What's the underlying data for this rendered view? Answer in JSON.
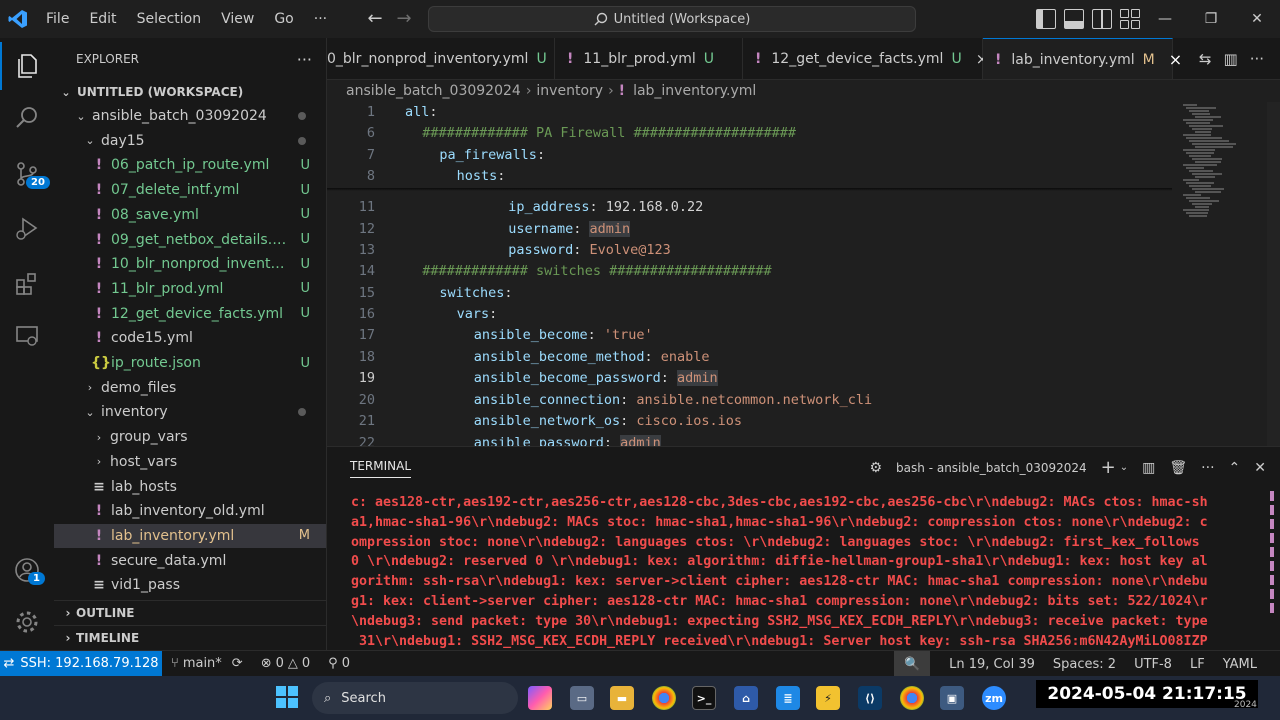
{
  "titlebar": {
    "logo": "VS Code logo",
    "menus": [
      "File",
      "Edit",
      "Selection",
      "View",
      "Go",
      "···"
    ],
    "command_center": "Untitled (Workspace)"
  },
  "activity": {
    "source_control_badge": "20",
    "accounts_badge": "1"
  },
  "sidebar": {
    "title": "EXPLORER",
    "workspace": "UNTITLED (WORKSPACE)",
    "items": [
      {
        "label": "ansible_batch_03092024",
        "kind": "folder-open",
        "depth": 1,
        "status": "dot"
      },
      {
        "label": "day15",
        "kind": "folder-open",
        "depth": 2,
        "status": "dot"
      },
      {
        "label": "06_patch_ip_route.yml",
        "kind": "yml",
        "depth": 3,
        "status": "U"
      },
      {
        "label": "07_delete_intf.yml",
        "kind": "yml",
        "depth": 3,
        "status": "U"
      },
      {
        "label": "08_save.yml",
        "kind": "yml",
        "depth": 3,
        "status": "U"
      },
      {
        "label": "09_get_netbox_details.yml",
        "kind": "yml",
        "depth": 3,
        "status": "U"
      },
      {
        "label": "10_blr_nonprod_inventory....",
        "kind": "yml",
        "depth": 3,
        "status": "U"
      },
      {
        "label": "11_blr_prod.yml",
        "kind": "yml",
        "depth": 3,
        "status": "U"
      },
      {
        "label": "12_get_device_facts.yml",
        "kind": "yml",
        "depth": 3,
        "status": "U"
      },
      {
        "label": "code15.yml",
        "kind": "yml",
        "depth": 3,
        "status": ""
      },
      {
        "label": "ip_route.json",
        "kind": "json",
        "depth": 3,
        "status": "U"
      },
      {
        "label": "demo_files",
        "kind": "folder",
        "depth": 2,
        "status": ""
      },
      {
        "label": "inventory",
        "kind": "folder-open",
        "depth": 2,
        "status": "dot"
      },
      {
        "label": "group_vars",
        "kind": "folder",
        "depth": 3,
        "status": ""
      },
      {
        "label": "host_vars",
        "kind": "folder",
        "depth": 3,
        "status": ""
      },
      {
        "label": "lab_hosts",
        "kind": "txt",
        "depth": 3,
        "status": ""
      },
      {
        "label": "lab_inventory_old.yml",
        "kind": "yml",
        "depth": 3,
        "status": ""
      },
      {
        "label": "lab_inventory.yml",
        "kind": "yml",
        "depth": 3,
        "status": "M",
        "selected": true
      },
      {
        "label": "secure_data.yml",
        "kind": "yml",
        "depth": 3,
        "status": ""
      },
      {
        "label": "vid1_pass",
        "kind": "txt",
        "depth": 3,
        "status": ""
      }
    ],
    "outline": "OUTLINE",
    "timeline": "TIMELINE"
  },
  "tabs": [
    {
      "label": "0_blr_nonprod_inventory.yml",
      "mark": "U",
      "active": false
    },
    {
      "label": "11_blr_prod.yml",
      "mark": "U",
      "active": false
    },
    {
      "label": "12_get_device_facts.yml",
      "mark": "U",
      "active": false,
      "close": "×"
    },
    {
      "label": "lab_inventory.yml",
      "mark": "M",
      "active": true,
      "close": "×"
    }
  ],
  "breadcrumb": [
    "ansible_batch_03092024",
    "inventory",
    "lab_inventory.yml"
  ],
  "editor": {
    "current_line": "19",
    "lines": [
      {
        "n": "1",
        "indent": 0,
        "parts": [
          [
            "k",
            "all"
          ],
          [
            "p",
            ":"
          ]
        ]
      },
      {
        "n": "6",
        "indent": 2,
        "parts": [
          [
            "c",
            "############# PA Firewall ####################"
          ]
        ]
      },
      {
        "n": "7",
        "indent": 4,
        "parts": [
          [
            "k",
            "pa_firewalls"
          ],
          [
            "p",
            ":"
          ]
        ]
      },
      {
        "n": "8",
        "indent": 6,
        "parts": [
          [
            "k",
            "hosts"
          ],
          [
            "p",
            ":"
          ]
        ]
      },
      {
        "n": "11",
        "indent": 12,
        "parts": [
          [
            "k",
            "ip_address"
          ],
          [
            "p",
            ": "
          ],
          [
            "v",
            "192.168.0.22"
          ]
        ]
      },
      {
        "n": "12",
        "indent": 12,
        "parts": [
          [
            "k",
            "username"
          ],
          [
            "p",
            ": "
          ],
          [
            "h",
            "admin"
          ]
        ]
      },
      {
        "n": "13",
        "indent": 12,
        "parts": [
          [
            "k",
            "password"
          ],
          [
            "p",
            ": "
          ],
          [
            "s",
            "Evolve@123"
          ]
        ]
      },
      {
        "n": "14",
        "indent": 2,
        "parts": [
          [
            "c",
            "############# switches ####################"
          ]
        ]
      },
      {
        "n": "15",
        "indent": 4,
        "parts": [
          [
            "k",
            "switches"
          ],
          [
            "p",
            ":"
          ]
        ]
      },
      {
        "n": "16",
        "indent": 6,
        "parts": [
          [
            "k",
            "vars"
          ],
          [
            "p",
            ":"
          ]
        ]
      },
      {
        "n": "17",
        "indent": 8,
        "parts": [
          [
            "k",
            "ansible_become"
          ],
          [
            "p",
            ": "
          ],
          [
            "s",
            "'true'"
          ]
        ]
      },
      {
        "n": "18",
        "indent": 8,
        "parts": [
          [
            "k",
            "ansible_become_method"
          ],
          [
            "p",
            ": "
          ],
          [
            "s",
            "enable"
          ]
        ]
      },
      {
        "n": "19",
        "indent": 8,
        "parts": [
          [
            "k",
            "ansible_become_password"
          ],
          [
            "p",
            ": "
          ],
          [
            "h",
            "admin"
          ]
        ]
      },
      {
        "n": "20",
        "indent": 8,
        "parts": [
          [
            "k",
            "ansible_connection"
          ],
          [
            "p",
            ": "
          ],
          [
            "s",
            "ansible.netcommon.network_cli"
          ]
        ]
      },
      {
        "n": "21",
        "indent": 8,
        "parts": [
          [
            "k",
            "ansible_network_os"
          ],
          [
            "p",
            ": "
          ],
          [
            "s",
            "cisco.ios.ios"
          ]
        ]
      },
      {
        "n": "22",
        "indent": 8,
        "parts": [
          [
            "k",
            "ansible_password"
          ],
          [
            "p",
            ": "
          ],
          [
            "h",
            "admin"
          ]
        ]
      }
    ]
  },
  "panel": {
    "title": "TERMINAL",
    "shell": "bash - ansible_batch_03092024",
    "lines": [
      "c: aes128-ctr,aes192-ctr,aes256-ctr,aes128-cbc,3des-cbc,aes192-cbc,aes256-cbc\\r\\ndebug2: MACs ctos: hmac-sh",
      "a1,hmac-sha1-96\\r\\ndebug2: MACs stoc: hmac-sha1,hmac-sha1-96\\r\\ndebug2: compression ctos: none\\r\\ndebug2: c",
      "ompression stoc: none\\r\\ndebug2: languages ctos: \\r\\ndebug2: languages stoc: \\r\\ndebug2: first_kex_follows",
      "0 \\r\\ndebug2: reserved 0 \\r\\ndebug1: kex: algorithm: diffie-hellman-group1-sha1\\r\\ndebug1: kex: host key al",
      "gorithm: ssh-rsa\\r\\ndebug1: kex: server->client cipher: aes128-ctr MAC: hmac-sha1 compression: none\\r\\ndebu",
      "g1: kex: client->server cipher: aes128-ctr MAC: hmac-sha1 compression: none\\r\\ndebug2: bits set: 522/1024\\r",
      "\\ndebug3: send packet: type 30\\r\\ndebug1: expecting SSH2_MSG_KEX_ECDH_REPLY\\r\\ndebug3: receive packet: type",
      " 31\\r\\ndebug1: SSH2_MSG_KEX_ECDH_REPLY received\\r\\ndebug1: Server host key: ssh-rsa SHA256:m6N42AyMiLO08IZP"
    ]
  },
  "statusbar": {
    "remote": "SSH: 192.168.79.128",
    "branch": "main*",
    "errors": "0",
    "warnings": "0",
    "ports": "0",
    "cursor": "Ln 19, Col 39",
    "spaces": "Spaces: 2",
    "encoding": "UTF-8",
    "eol": "LF",
    "language": "YAML"
  },
  "taskbar": {
    "search": "Search",
    "datetime": "2024-05-04 21:17:15",
    "year": "2024"
  },
  "colors": {
    "accent": "#0078d4",
    "untracked": "#73c991",
    "modified": "#e2c08d",
    "terminal_error": "#f14c4c"
  }
}
